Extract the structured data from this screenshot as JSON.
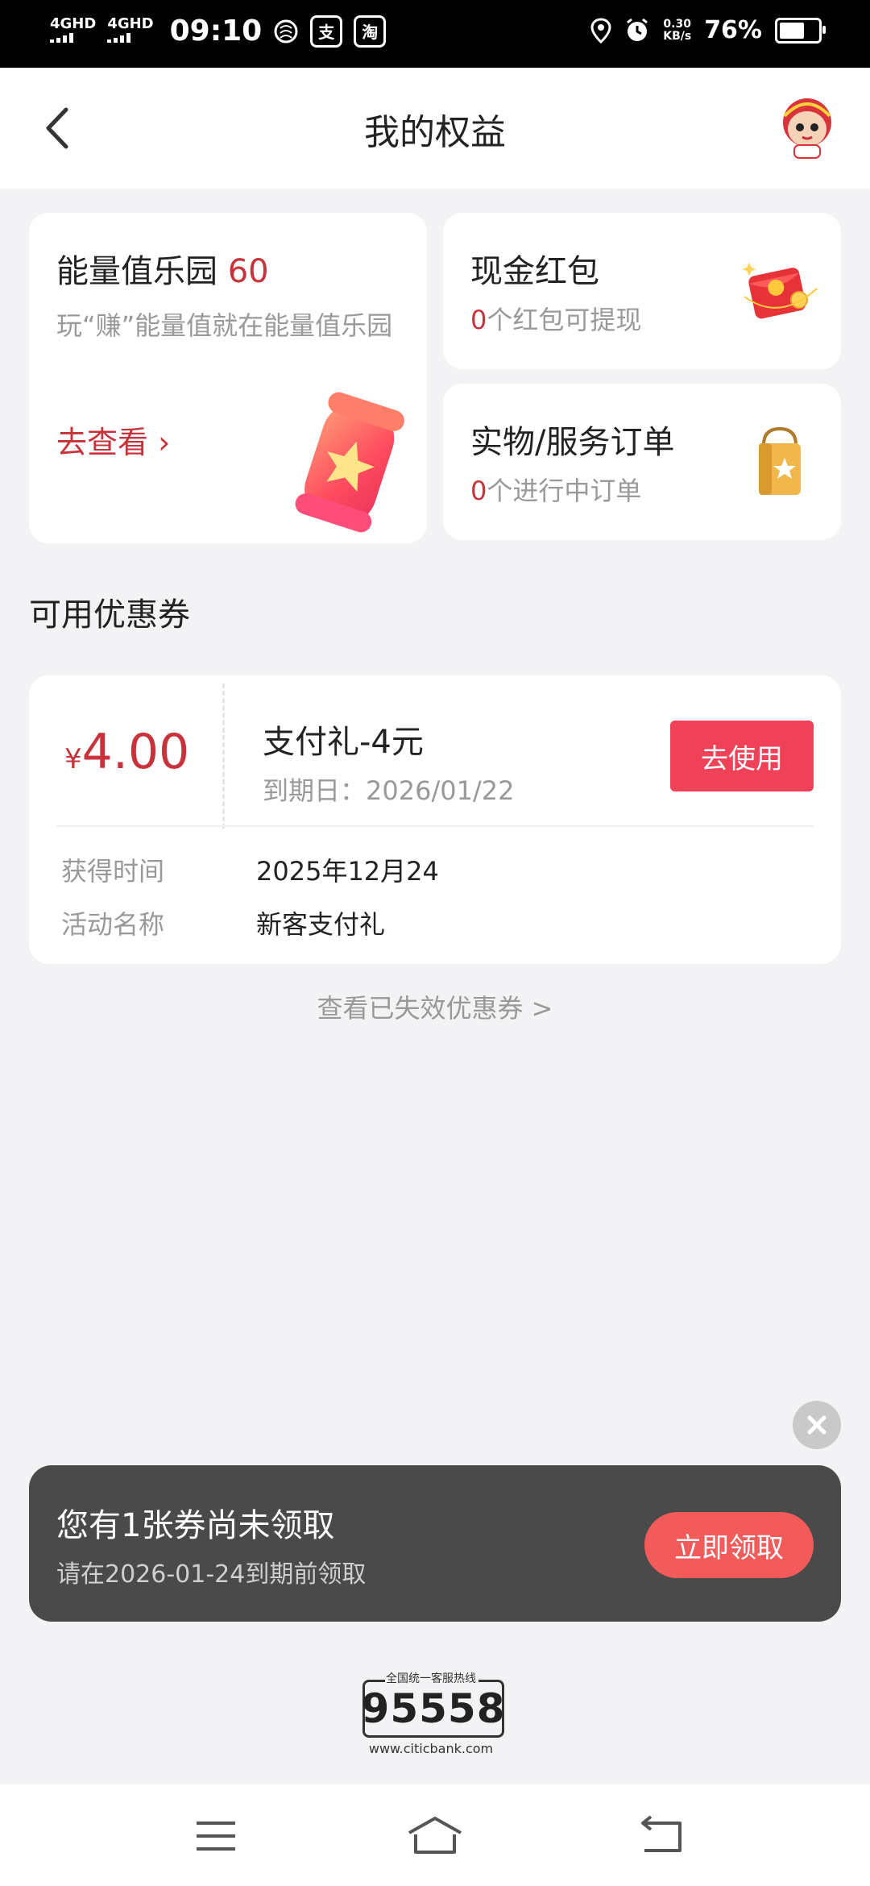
{
  "status_bar": {
    "net1": "4GHD",
    "net2": "4GHD",
    "time": "09:10",
    "app_icon_1": "支",
    "app_icon_2": "淘",
    "speed_value": "0.30",
    "speed_unit": "KB/s",
    "battery": "76%",
    "battery_level": 0.76
  },
  "header": {
    "title": "我的权益"
  },
  "energy_card": {
    "title": "能量值乐园",
    "value": "60",
    "desc": "玩“赚”能量值就在能量值乐园",
    "link": "去查看 ›"
  },
  "redpack_card": {
    "title": "现金红包",
    "count": "0",
    "sub": "个红包可提现"
  },
  "orders_card": {
    "title": "实物/服务订单",
    "count": "0",
    "sub": "个进行中订单"
  },
  "section_title": "可用优惠券",
  "coupon": {
    "currency": "¥",
    "amount": "4.00",
    "name": "支付礼-4元",
    "expire": "到期日：2026/01/22",
    "button": "去使用",
    "row1_key": "获得时间",
    "row1_val": "2025年12月24",
    "row2_key": "活动名称",
    "row2_val": "新客支付礼"
  },
  "expired_link": "查看已失效优惠券 >",
  "toast": {
    "title": "您有1张券尚未领取",
    "sub": "请在2026-01-24到期前领取",
    "button": "立即领取"
  },
  "hotline": {
    "caption": "全国统一客服热线",
    "number": "95558",
    "url": "www.citicbank.com"
  },
  "colors": {
    "accent_red": "#c8323a",
    "button_red": "#ef4258",
    "toast_bg": "#4a4a4a"
  }
}
